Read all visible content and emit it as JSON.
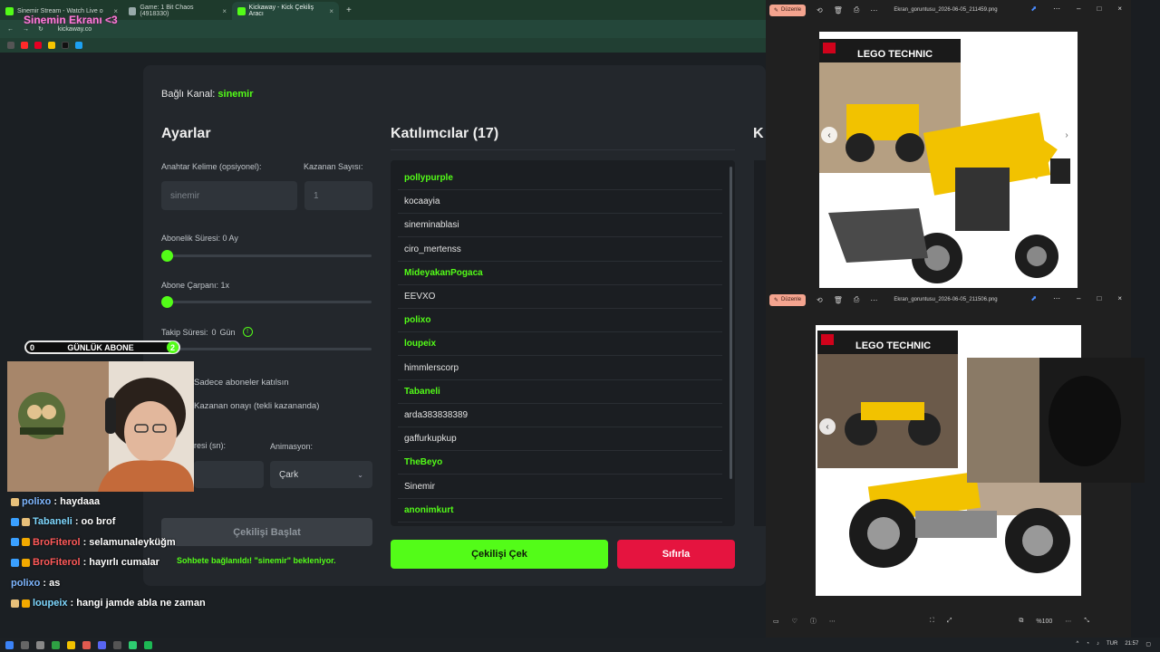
{
  "browser": {
    "tabs": [
      {
        "label": "Sinemir Stream - Watch Live o",
        "active": false
      },
      {
        "label": "Game: 1 Bit Chaos (4918330)",
        "active": false
      },
      {
        "label": "Kickaway - Kick Çekiliş Aracı",
        "active": true
      }
    ],
    "url": "kickaway.co",
    "overlay_title": "Sinemin Ekranı <3"
  },
  "app": {
    "channel_label": "Bağlı Kanal:",
    "channel_name": "sinemir",
    "settings": {
      "title": "Ayarlar",
      "keyword_label": "Anahtar Kelime (opsiyonel):",
      "keyword_placeholder": "sinemir",
      "winners_label": "Kazanan Sayısı:",
      "winners_placeholder": "1",
      "sub_duration_label": "Abonelik Süresi: 0 Ay",
      "sub_multiplier_label": "Abone Çarpanı: 1x",
      "follow_label": "Takip Süresi:",
      "follow_value": "0",
      "follow_unit": "Gün",
      "subs_only_label": "Sadece aboneler katılsın",
      "winner_approval_label": "Kazanan onayı (tekli kazananda)",
      "duration_label": "resi (sn):",
      "animation_label": "Animasyon:",
      "animation_value": "Çark",
      "start_button": "Çekilişi Başlat",
      "status_message": "Sohbete bağlanıldı! \"sinemir\" bekleniyor."
    },
    "participants": {
      "title": "Katılımcılar (17)",
      "items": [
        {
          "name": "pollypurple",
          "sub": true
        },
        {
          "name": "kocaayia",
          "sub": false
        },
        {
          "name": "sineminablasi",
          "sub": false
        },
        {
          "name": "ciro_mertenss",
          "sub": false
        },
        {
          "name": "MideyakanPogaca",
          "sub": true
        },
        {
          "name": "EEVXO",
          "sub": false
        },
        {
          "name": "polixo",
          "sub": true
        },
        {
          "name": "loupeix",
          "sub": true
        },
        {
          "name": "himmlerscorp",
          "sub": false
        },
        {
          "name": "Tabaneli",
          "sub": true
        },
        {
          "name": "arda383838389",
          "sub": false
        },
        {
          "name": "gaffurkupkup",
          "sub": false
        },
        {
          "name": "TheBeyo",
          "sub": true
        },
        {
          "name": "Sinemir",
          "sub": false
        },
        {
          "name": "anonimkurt",
          "sub": true
        }
      ],
      "draw_button": "Çekilişi Çek",
      "reset_button": "Sıfırla"
    },
    "third_column_title": "K"
  },
  "overlay": {
    "sub_goal": {
      "left": "0",
      "label": "GÜNLÜK ABONE",
      "right": "2"
    },
    "chat": [
      {
        "user": "polixo",
        "user_color": "#7fb7ff",
        "message": ": haydaaa"
      },
      {
        "user": "Tabaneli",
        "user_color": "#7fd8ff",
        "message": ": oo brof"
      },
      {
        "user": "BroFiterol",
        "user_color": "#ff5a5a",
        "message": ": selamunaleyküğm"
      },
      {
        "user": "BroFiterol",
        "user_color": "#ff5a5a",
        "message": ": hayırlı cumalar"
      },
      {
        "user": "polixo",
        "user_color": "#7fb7ff",
        "message": ": as"
      },
      {
        "user": "loupeix",
        "user_color": "#7fd8ff",
        "message": ": hangi jamde abla ne zaman"
      }
    ]
  },
  "viewers": [
    {
      "edit_label": "Düzenle",
      "filename": "Ekran_goruntusu_2026-06-05_211459.png",
      "product": "LEGO TECHNIC"
    },
    {
      "edit_label": "Düzenle",
      "filename": "Ekran_goruntusu_2026-06-05_211506.png",
      "product": "LEGO TECHNIC"
    }
  ],
  "viewer_bottom": {
    "zoom": "%100"
  },
  "taskbar": {
    "lang": "TUR",
    "time": "21:57"
  },
  "colors": {
    "kick_green": "#53fc18",
    "reset_red": "#e5143f",
    "panel": "#23272c"
  }
}
